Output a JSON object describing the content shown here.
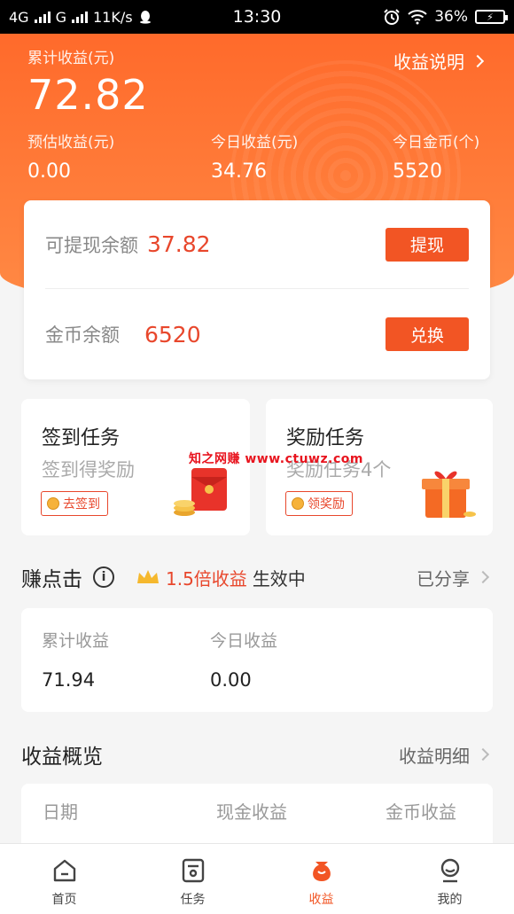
{
  "status_bar": {
    "network1": "4G",
    "network2": "G",
    "speed": "11K/s",
    "time": "13:30",
    "battery": "36%",
    "icons": [
      "signal-icon",
      "qq-icon",
      "alarm-icon",
      "wifi-icon",
      "battery-icon"
    ]
  },
  "summary": {
    "total_label": "累计收益(元)",
    "total_value": "72.82",
    "explain_label": "收益说明",
    "stats": [
      {
        "label": "预估收益(元)",
        "value": "0.00"
      },
      {
        "label": "今日收益(元)",
        "value": "34.76"
      },
      {
        "label": "今日金币(个)",
        "value": "5520"
      }
    ]
  },
  "balance": {
    "cash_label": "可提现余额",
    "cash_value": "37.82",
    "withdraw_label": "提现",
    "coin_label": "金币余额",
    "coin_value": "6520",
    "exchange_label": "兑换"
  },
  "tasks": [
    {
      "title": "签到任务",
      "subtitle": "签到得奖励",
      "button": "去签到"
    },
    {
      "title": "奖励任务",
      "subtitle": "奖励任务4个",
      "button": "领奖励"
    }
  ],
  "watermark": "知之网赚  www.ctuwz.com",
  "click_section": {
    "title": "赚点击",
    "bonus_highlight": "1.5倍收益",
    "bonus_rest": "生效中",
    "shared_label": "已分享",
    "cumulative_label": "累计收益",
    "cumulative_value": "71.94",
    "today_label": "今日收益",
    "today_value": "0.00"
  },
  "overview": {
    "title": "收益概览",
    "detail_label": "收益明细",
    "columns": [
      "日期",
      "现金收益",
      "金币收益"
    ]
  },
  "tabbar": {
    "active": "收益",
    "items": [
      {
        "label": "首页",
        "icon": "home-icon"
      },
      {
        "label": "任务",
        "icon": "task-icon"
      },
      {
        "label": "收益",
        "icon": "money-bag-icon"
      },
      {
        "label": "我的",
        "icon": "profile-icon"
      }
    ]
  },
  "colors": {
    "brand_orange": "#f25524",
    "hero_top": "#ff6a2b",
    "hero_bottom": "#ff8a45",
    "amount_red": "#e8472c"
  }
}
